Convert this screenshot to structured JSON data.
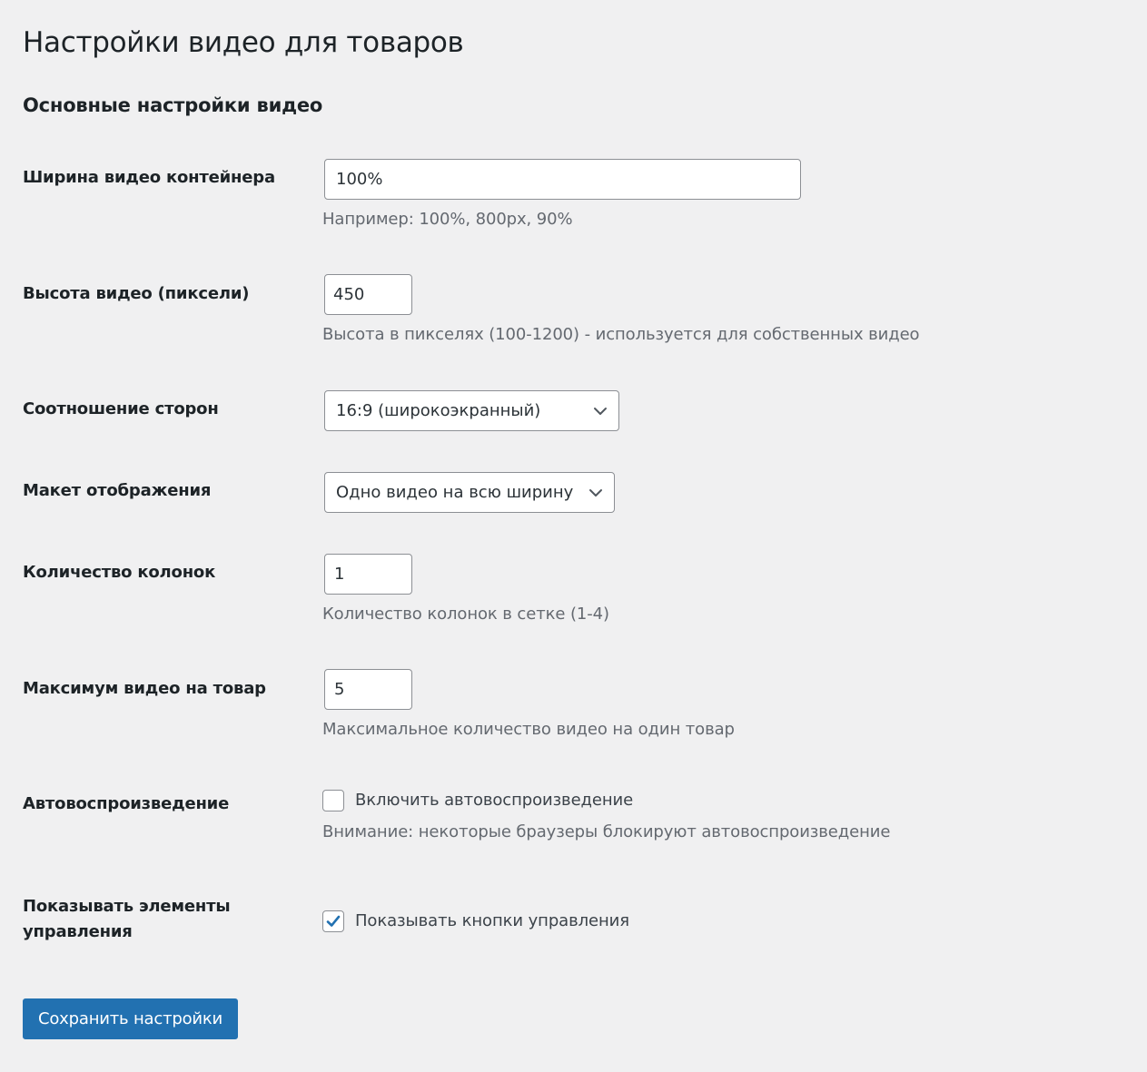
{
  "page": {
    "title": "Настройки видео для товаров",
    "section_title": "Основные настройки видео"
  },
  "fields": {
    "container_width": {
      "label": "Ширина видео контейнера",
      "value": "100%",
      "description": "Например: 100%, 800px, 90%"
    },
    "video_height": {
      "label": "Высота видео (пиксели)",
      "value": "450",
      "description": "Высота в пикселях (100-1200) - используется для собственных видео"
    },
    "aspect_ratio": {
      "label": "Соотношение сторон",
      "selected": "16:9 (широкоэкранный)"
    },
    "layout": {
      "label": "Макет отображения",
      "selected": "Одно видео на всю ширину"
    },
    "columns": {
      "label": "Количество колонок",
      "value": "1",
      "description": "Количество колонок в сетке (1-4)"
    },
    "max_videos": {
      "label": "Максимум видео на товар",
      "value": "5",
      "description": "Максимальное количество видео на один товар"
    },
    "autoplay": {
      "label": "Автовоспроизведение",
      "checkbox_label": "Включить автовоспроизведение",
      "checked": false,
      "description": "Внимание: некоторые браузеры блокируют автовоспроизведение"
    },
    "controls": {
      "label_line1": "Показывать элементы",
      "label_line2": "управления",
      "checkbox_label": "Показывать кнопки управления",
      "checked": true
    }
  },
  "actions": {
    "save_label": "Сохранить настройки"
  },
  "colors": {
    "background": "#f0f0f1",
    "primary_button": "#2271b1",
    "checkmark": "#2271b1",
    "description_text": "#646970"
  },
  "icons": {
    "select_arrow": "chevron-down-icon",
    "checkmark": "checkmark-icon"
  }
}
